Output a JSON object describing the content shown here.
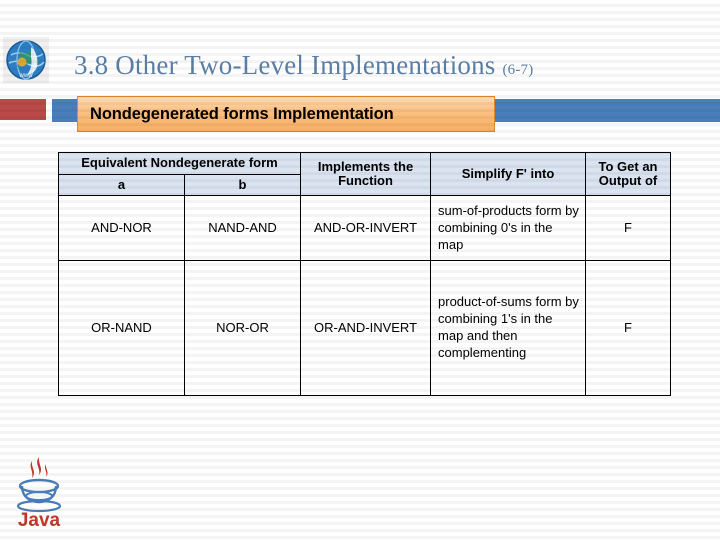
{
  "slide": {
    "title_main": "3.8 Other Two-Level Implementations",
    "title_ref": "(6-7)",
    "banner_label": "Nondegenerated forms Implementation",
    "globe_icon": "globe-icon",
    "java_logo_label": "Java",
    "colors": {
      "title": "#5b7fa6",
      "accent_red": "#b94a48",
      "accent_blue": "#4a7ebb",
      "banner_orange": "#fbc183",
      "table_header": "#dae3f0",
      "table_border": "#000000"
    }
  },
  "table": {
    "group_header": "Equivalent Nondegenerate form",
    "sub_headers": [
      "a",
      "b"
    ],
    "headers": [
      "Implements the Function",
      "Simplify F' into",
      "To Get an Output of"
    ],
    "rows": [
      {
        "a": "AND-NOR",
        "b": "NAND-AND",
        "implements": "AND-OR-INVERT",
        "simplify": "sum-of-products form by combining 0's in the map",
        "output": "F"
      },
      {
        "a": "OR-NAND",
        "b": "NOR-OR",
        "implements": "OR-AND-INVERT",
        "simplify": "product-of-sums form by combining 1's in the map and then complementing",
        "output": "F"
      }
    ]
  }
}
